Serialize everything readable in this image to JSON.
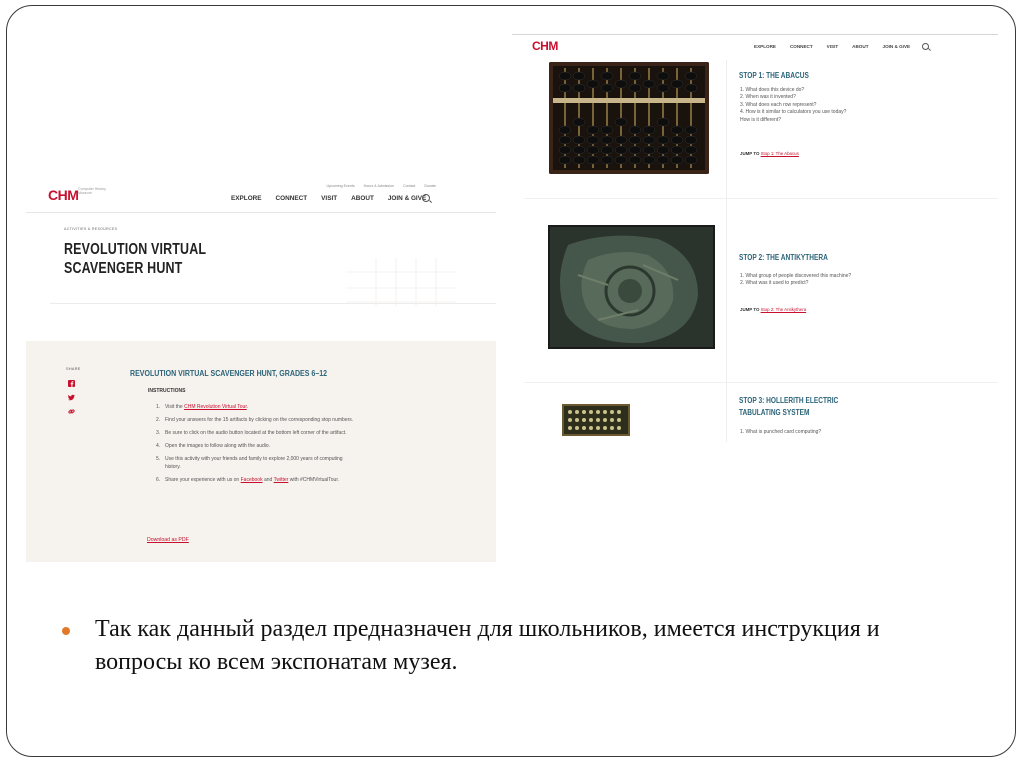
{
  "left_shot": {
    "logo": "CHM",
    "logo_sub": "Computer History Museum",
    "utility_links": [
      "Upcoming Events",
      "Hours & Admission",
      "Contact",
      "Donate"
    ],
    "nav": [
      "EXPLORE",
      "CONNECT",
      "VISIT",
      "ABOUT",
      "JOIN & GIVE"
    ],
    "breadcrumb": "ACTIVITIES & RESOURCES",
    "title": "REVOLUTION VIRTUAL SCAVENGER HUNT",
    "share_label": "SHARE",
    "heading": "REVOLUTION VIRTUAL SCAVENGER HUNT, GRADES 6–12",
    "instructions_label": "INSTRUCTIONS",
    "steps": {
      "s1_pre": "Visit the ",
      "s1_link": "CHM Revolution Virtual Tour",
      "s1_post": ".",
      "s2": "Find your answers for the 15 artifacts by clicking on the corresponding stop numbers.",
      "s3": "Be sure to click on the audio button located at the bottom left corner of the artifact.",
      "s4": "Open the images to follow along with the audio.",
      "s5": "Use this activity with your friends and family to explore 2,000 years of computing history.",
      "s6_pre": "Share your experience with us on ",
      "s6_link1": "Facebook",
      "s6_mid": " and ",
      "s6_link2": "Twitter",
      "s6_post": " with #CHMVirtualTour."
    },
    "numbers": [
      "1.",
      "2.",
      "3.",
      "4.",
      "5.",
      "6."
    ],
    "pdf_link": "Download as PDF"
  },
  "right_shot": {
    "logo": "CHM",
    "nav": [
      "EXPLORE",
      "CONNECT",
      "VISIT",
      "ABOUT",
      "JOIN & GIVE"
    ],
    "stops": [
      {
        "title": "STOP 1: THE ABACUS",
        "questions": [
          "1. What does this device do?",
          "2. When was it invented?",
          "3. What does each row represent?",
          "4. How is it similar to calculators you use today?",
          "How is it different?"
        ],
        "jump_label": "JUMP TO ",
        "jump_link": "Stop 1: The Abacus"
      },
      {
        "title": "STOP 2: THE ANTIKYTHERA",
        "questions": [
          "1. What group of people discovered this machine?",
          "2. What was it used to predict?"
        ],
        "jump_label": "JUMP TO ",
        "jump_link": "Stop 2: The Antikythera"
      },
      {
        "title": "STOP 3: HOLLERITH ELECTRIC TABULATING SYSTEM",
        "questions": [
          "1. What is punched card computing?"
        ]
      }
    ]
  },
  "bullet": {
    "text": "Так как данный раздел предназначен для школьников, имеется инструкция и вопросы ко всем экспонатам  музея."
  },
  "colors": {
    "brand_red": "#c8102e",
    "heading_teal": "#2a6378",
    "bullet_orange": "#e07a2a",
    "panel_beige": "#f6f2ee"
  }
}
